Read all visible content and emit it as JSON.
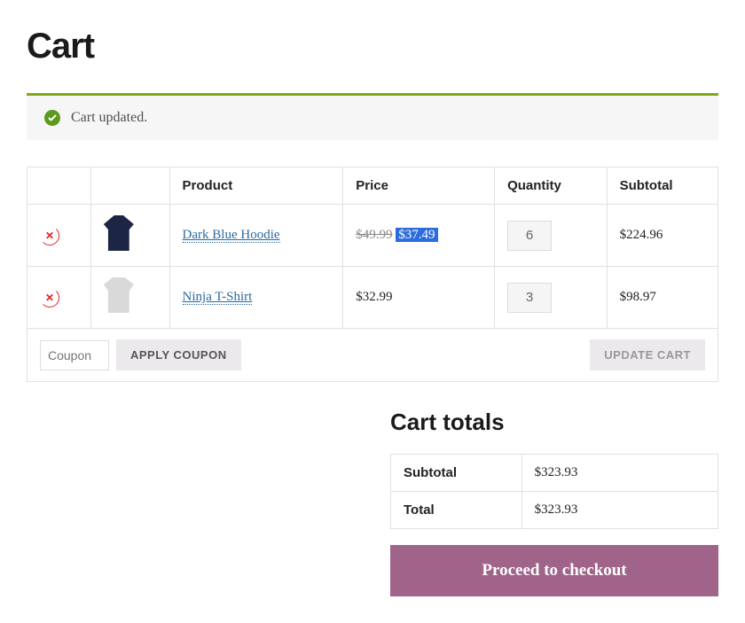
{
  "page": {
    "title": "Cart"
  },
  "notice": {
    "text": "Cart updated."
  },
  "table": {
    "headers": {
      "product": "Product",
      "price": "Price",
      "quantity": "Quantity",
      "subtotal": "Subtotal"
    },
    "items": [
      {
        "name": "Dark Blue Hoodie",
        "price_original": "$49.99",
        "price_sale": "$37.49",
        "quantity": "6",
        "subtotal": "$224.96",
        "thumb_class": "hoodie"
      },
      {
        "name": "Ninja T-Shirt",
        "price": "$32.99",
        "quantity": "3",
        "subtotal": "$98.97",
        "thumb_class": "tshirt"
      }
    ]
  },
  "coupon": {
    "placeholder": "Coupon",
    "apply_label": "Apply Coupon"
  },
  "update": {
    "label": "Update Cart"
  },
  "totals": {
    "title": "Cart totals",
    "subtotal_label": "Subtotal",
    "subtotal_value": "$323.93",
    "total_label": "Total",
    "total_value": "$323.93"
  },
  "checkout": {
    "label": "Proceed to checkout"
  }
}
